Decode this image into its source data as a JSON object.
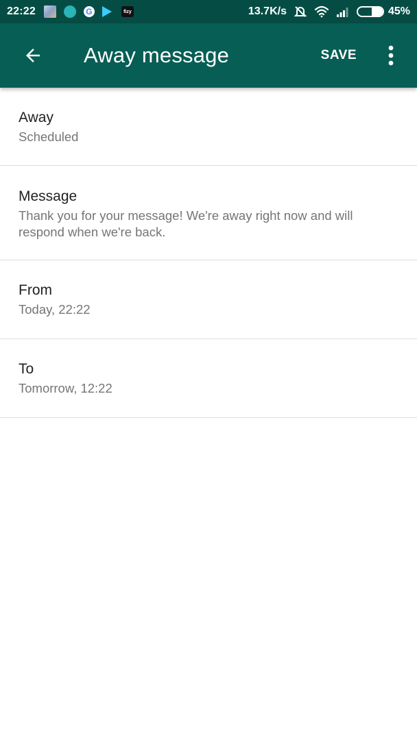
{
  "status_bar": {
    "time": "22:22",
    "notification_icons": [
      "gallery-photo-icon",
      "circle-app-icon",
      "google-icon",
      "play-store-icon",
      "fizy-icon"
    ],
    "fizy_label": "fizy",
    "google_label": "G",
    "network_speed": "13.7K/s",
    "status_icons": [
      "alarm-off-icon",
      "wifi-icon",
      "signal-icon",
      "battery-icon"
    ],
    "battery_percent": 45,
    "battery_label": "45%"
  },
  "app_bar": {
    "title": "Away message",
    "save_label": "SAVE",
    "color": "#075e54"
  },
  "settings": [
    {
      "title": "Away",
      "subtitle": "Scheduled"
    },
    {
      "title": "Message",
      "subtitle": "Thank you for your message! We're away right now and will respond when we're back."
    },
    {
      "title": "From",
      "subtitle": "Today, 22:22"
    },
    {
      "title": "To",
      "subtitle": "Tomorrow, 12:22"
    }
  ]
}
